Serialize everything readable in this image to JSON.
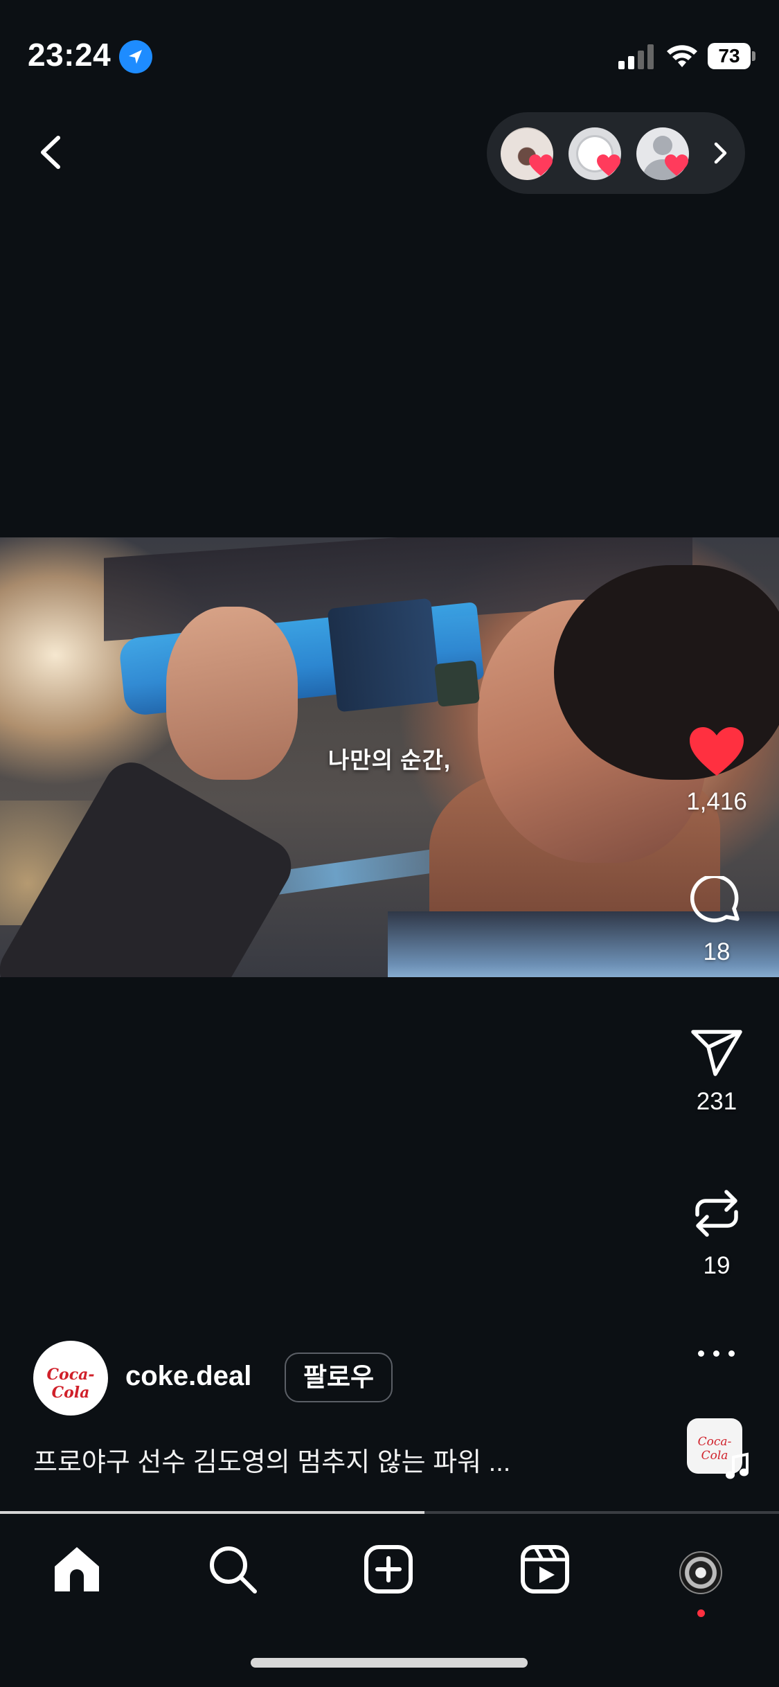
{
  "status_bar": {
    "time": "23:24",
    "battery_level": "73",
    "icons": [
      "location-arrow-icon",
      "cellular-signal-icon",
      "wifi-icon",
      "battery-icon"
    ]
  },
  "nav": {
    "back_icon": "chevron-left-icon",
    "likers_icon": "chevron-right-icon"
  },
  "media": {
    "caption": "나만의 순간,",
    "progress_fraction": 0.545
  },
  "actions": {
    "likes": "1,416",
    "comments": "18",
    "shares": "231",
    "reposts": "19",
    "liked": true,
    "like_color": "#ff3040"
  },
  "audio": {
    "thumb_text": "Coca-Cola",
    "icon": "music-note-icon"
  },
  "post": {
    "author_logo_text": "Coca-Cola",
    "author": "coke.deal",
    "follow_label": "팔로우",
    "caption": "프로야구 선수 김도영의 멈추지 않는 파워 ..."
  },
  "tab_bar": {
    "items": [
      "home-icon",
      "search-icon",
      "create-icon",
      "reels-icon",
      "profile-avatar"
    ],
    "notification_color": "#ff3040"
  }
}
